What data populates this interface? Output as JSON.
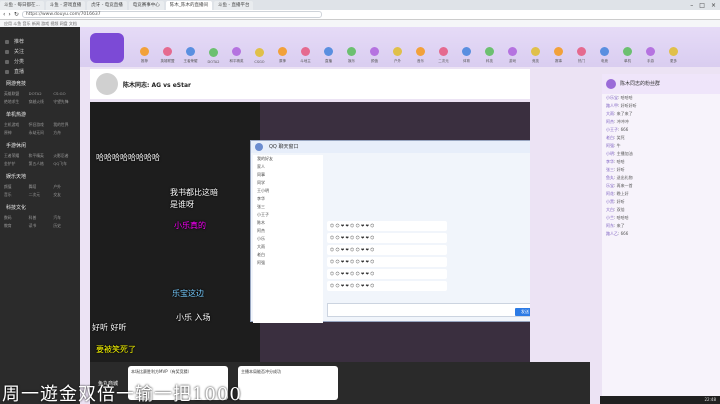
{
  "browser": {
    "tabs": [
      "斗鱼 - 每日都在...",
      "斗鱼 - 游戏直播",
      "虎牙 - 电竞直播",
      "电竞赛事中心",
      "陈木_陈木的直播间",
      "斗鱼 - 直播平台"
    ],
    "url": "https://www.douyu.com/7016637",
    "bookmarks": "应用   斗鱼   音乐   新闻   游戏   视频   网盘   文档"
  },
  "sidebar": {
    "items": [
      "推荐",
      "关注",
      "分类",
      "直播"
    ],
    "sections": [
      {
        "head": "网游竞技",
        "cells": [
          "英雄联盟",
          "DOTA2",
          "CS:GO",
          "绝地求生",
          "穿越火线",
          "守望先锋"
        ]
      },
      {
        "head": "单机热游",
        "cells": [
          "主机游戏",
          "怀旧游戏",
          "我的世界",
          "原神",
          "永劫无间",
          "方舟"
        ]
      },
      {
        "head": "手游休闲",
        "cells": [
          "王者荣耀",
          "和平精英",
          "火影忍者",
          "金铲铲",
          "第五人格",
          "QQ飞车"
        ]
      },
      {
        "head": "娱乐天地",
        "cells": [
          "颜值",
          "舞蹈",
          "户外",
          "音乐",
          "二次元",
          "交友"
        ]
      },
      {
        "head": "科技文化",
        "cells": [
          "数码",
          "科普",
          "汽车",
          "教育",
          "读书",
          "历史"
        ]
      }
    ]
  },
  "navbar": {
    "items": [
      "推荐",
      "英雄联盟",
      "王者荣耀",
      "DOTA2",
      "和平精英",
      "CSGO",
      "原神",
      "斗地主",
      "直播",
      "娱乐",
      "颜值",
      "户外",
      "音乐",
      "二次元",
      "体育",
      "科技",
      "游戏",
      "竞技",
      "赛事",
      "热门",
      "电竞",
      "单机",
      "手游",
      "更多"
    ],
    "colors": [
      "#f2a13a",
      "#e56a8f",
      "#5a8fe0",
      "#6cc070",
      "#b573e0",
      "#e0c04a"
    ]
  },
  "room": {
    "title": "陈木同志: AG vs eStar"
  },
  "qq": {
    "window_title": "QQ 聊天窗口",
    "contacts": [
      "我的好友",
      "家人",
      "同事",
      "同学",
      "王小明",
      "李华",
      "张三",
      "小王子",
      "陈木",
      "阿杰",
      "小乐",
      "大雨",
      "老白",
      "阿强"
    ],
    "messages": [
      "😊 😊 ❤ ❤ 😊 😊 ❤ ❤ 😊",
      "😊 😊 ❤ ❤ 😊 😊 ❤ ❤ 😊",
      "😊 😊 ❤ ❤ 😊 😊 ❤ ❤ 😊",
      "😊 😊 ❤ ❤ 😊 😊 ❤ ❤ 😊",
      "😊 😊 ❤ ❤ 😊 😊 ❤ ❤ 😊",
      "😊 😊 ❤ ❤ 😊 😊 ❤ ❤ 😊"
    ],
    "send_label": "发送"
  },
  "danmu": [
    "哈哈哈哈哈哈哈哈",
    "我书都比这暗",
    "是谁呀",
    "小乐真的",
    "乐宝这边",
    "小乐 入场",
    "好听 好听",
    "要被笑死了"
  ],
  "promo": {
    "logo": "鱼丸商城",
    "cards": [
      "本场比赛胜利方MVP（有奖竞猜）",
      "主播本局能否冲分成功"
    ]
  },
  "chat_panel": {
    "header": "陈木同志的粉丝群",
    "lines": [
      {
        "user": "小乐宝",
        "text": "哈哈哈"
      },
      {
        "user": "路人甲",
        "text": "好听好听"
      },
      {
        "user": "大雨",
        "text": "来了来了"
      },
      {
        "user": "阿杰",
        "text": "冲冲冲"
      },
      {
        "user": "小王子",
        "text": "666"
      },
      {
        "user": "老白",
        "text": "笑死"
      },
      {
        "user": "阿强",
        "text": "牛"
      },
      {
        "user": "小明",
        "text": "主播加油"
      },
      {
        "user": "李华",
        "text": "哈哈"
      },
      {
        "user": "张三",
        "text": "好听"
      },
      {
        "user": "鱼丸",
        "text": "送出礼物"
      },
      {
        "user": "乐宝",
        "text": "再来一首"
      },
      {
        "user": "阿花",
        "text": "晚上好"
      },
      {
        "user": "小黑",
        "text": "好听"
      },
      {
        "user": "大白",
        "text": "双倍"
      },
      {
        "user": "小兰",
        "text": "哈哈哈"
      },
      {
        "user": "阿东",
        "text": "来了"
      },
      {
        "user": "路人乙",
        "text": "666"
      }
    ]
  },
  "subtitle": "周一遊金双倍一输一把1000",
  "taskbar": {
    "clock": "22:48"
  }
}
